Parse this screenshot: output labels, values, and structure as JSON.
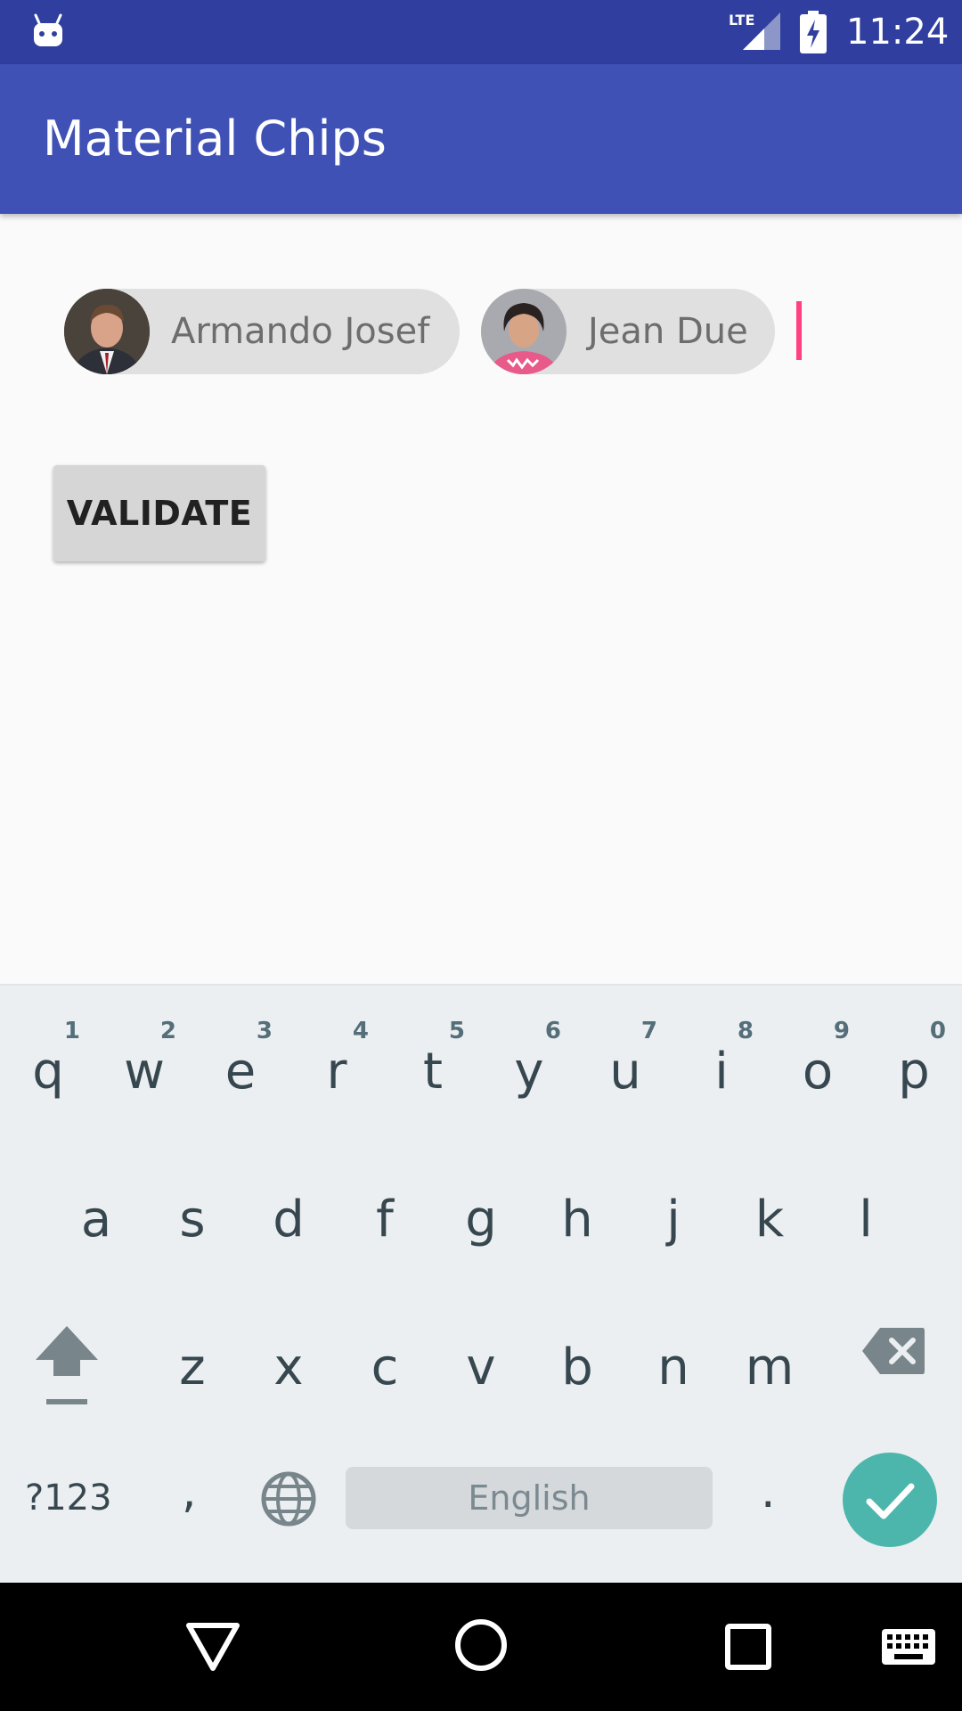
{
  "status_bar": {
    "time": "11:24",
    "network": "LTE",
    "icons": [
      "android-debug-icon",
      "lte-signal-icon",
      "battery-charging-icon"
    ]
  },
  "app_bar": {
    "title": "Material Chips"
  },
  "chips_input": {
    "chips": [
      {
        "label": "Armando Josef",
        "avatar": "avatar-man-suit"
      },
      {
        "label": "Jean Due",
        "avatar": "avatar-woman-dark-hair"
      }
    ],
    "cursor_color": "#ff4081"
  },
  "validate_button": {
    "label": "VALIDATE"
  },
  "keyboard": {
    "row1": [
      {
        "key": "q",
        "hint": "1"
      },
      {
        "key": "w",
        "hint": "2"
      },
      {
        "key": "e",
        "hint": "3"
      },
      {
        "key": "r",
        "hint": "4"
      },
      {
        "key": "t",
        "hint": "5"
      },
      {
        "key": "y",
        "hint": "6"
      },
      {
        "key": "u",
        "hint": "7"
      },
      {
        "key": "i",
        "hint": "8"
      },
      {
        "key": "o",
        "hint": "9"
      },
      {
        "key": "p",
        "hint": "0"
      }
    ],
    "row2": [
      "a",
      "s",
      "d",
      "f",
      "g",
      "h",
      "j",
      "k",
      "l"
    ],
    "row3": [
      "z",
      "x",
      "c",
      "v",
      "b",
      "n",
      "m"
    ],
    "symbols_label": "?123",
    "comma": ",",
    "period": ".",
    "space_label": "English",
    "enter_color": "#4db6ac"
  },
  "colors": {
    "primary": "#3f51b5",
    "primary_dark": "#303f9f",
    "accent": "#ff4081",
    "chip_bg": "#e0e0e0"
  }
}
